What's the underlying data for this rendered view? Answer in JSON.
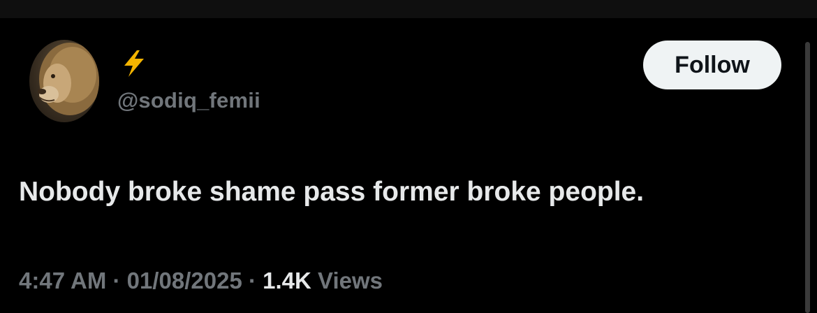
{
  "user": {
    "display_name_icon": "lightning-bolt-icon",
    "handle": "@sodiq_femii",
    "avatar": "lion-avatar"
  },
  "follow_label": "Follow",
  "tweet": {
    "text": "Nobody broke shame pass former broke people."
  },
  "meta": {
    "time": "4:47 AM",
    "sep1": " · ",
    "date": "01/08/2025",
    "sep2": " · ",
    "views_count": "1.4K",
    "views_label": " Views"
  },
  "colors": {
    "background": "#000000",
    "text": "#e7e9ea",
    "muted": "#71767b",
    "button_bg": "#eff3f4",
    "bolt": "#f4b400"
  }
}
